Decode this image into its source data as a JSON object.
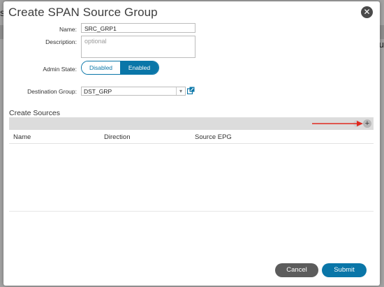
{
  "background": {
    "left_fragment": "s",
    "right_fragment": "u"
  },
  "modal": {
    "title": "Create SPAN Source Group",
    "close_icon": "close-icon"
  },
  "form": {
    "name": {
      "label": "Name:",
      "value": "SRC_GRP1"
    },
    "description": {
      "label": "Description:",
      "placeholder": "optional"
    },
    "admin_state": {
      "label": "Admin State:",
      "options": [
        "Disabled",
        "Enabled"
      ],
      "selected": "Enabled"
    },
    "destination_group": {
      "label": "Destination Group:",
      "value": "DST_GRP"
    }
  },
  "sources": {
    "title": "Create Sources",
    "columns": [
      "Name",
      "Direction",
      "Source EPG"
    ],
    "rows": []
  },
  "footer": {
    "cancel_label": "Cancel",
    "submit_label": "Submit"
  },
  "colors": {
    "accent": "#0a76a8",
    "cancel": "#5c5c5c",
    "annotation_arrow": "#e0291f"
  }
}
